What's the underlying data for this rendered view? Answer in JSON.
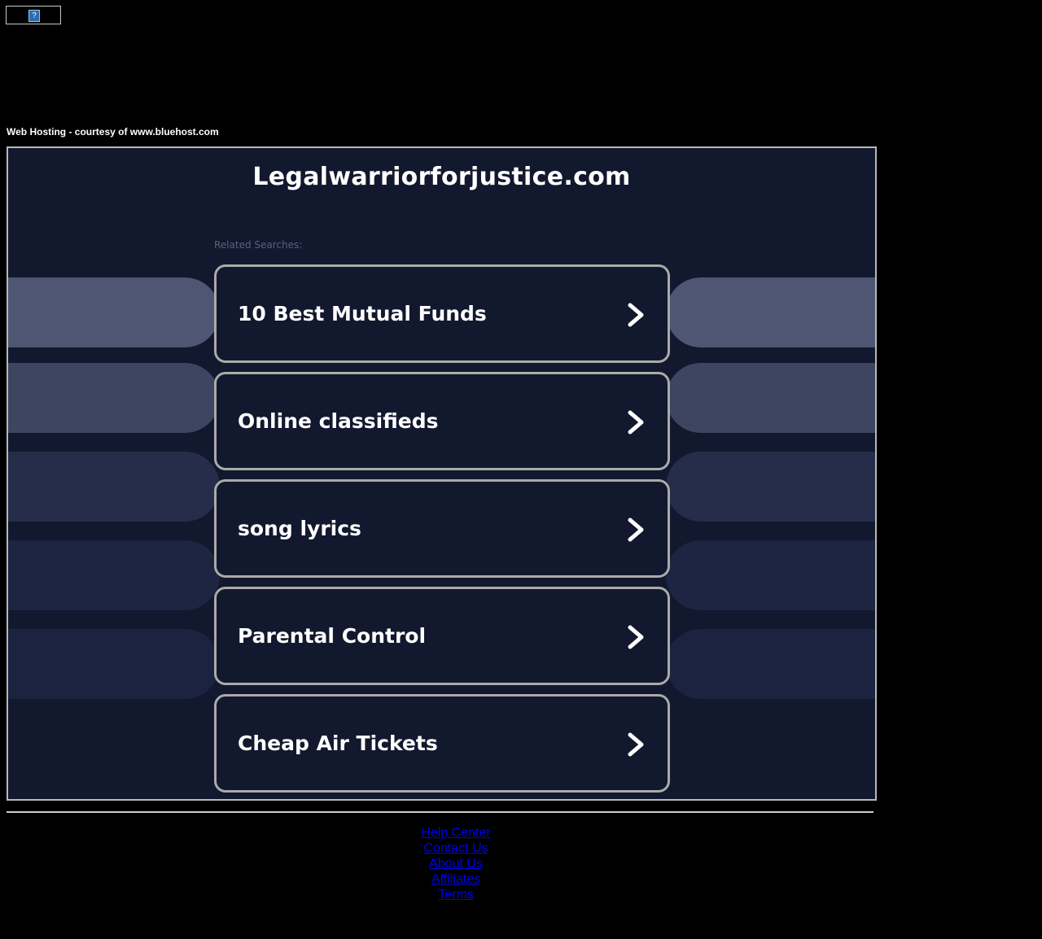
{
  "header": {
    "hosting_text": "Web Hosting - courtesy of www.bluehost.com",
    "broken_image_glyph": "?"
  },
  "main": {
    "domain": "Legalwarriorforjustice.com",
    "related_label": "Related Searches:",
    "searches": [
      {
        "label": "10 Best Mutual Funds",
        "icon": "chevron-right-icon"
      },
      {
        "label": "Online classifieds",
        "icon": "chevron-right-icon"
      },
      {
        "label": "song lyrics",
        "icon": "chevron-right-icon"
      },
      {
        "label": "Parental Control",
        "icon": "chevron-right-icon"
      },
      {
        "label": "Cheap Air Tickets",
        "icon": "chevron-right-icon"
      }
    ]
  },
  "footer": {
    "links": [
      "Help Center",
      "Contact Us",
      "About Us",
      "Affiliates",
      "Terms"
    ]
  },
  "colors": {
    "page_bg": "#000000",
    "panel_bg": "#12182d",
    "card_border": "#aaaaaa",
    "pill_shades": [
      "#4e5673",
      "#3d4561",
      "#262d4b",
      "#1e2542",
      "#1c2340"
    ],
    "link": "#0000ee"
  }
}
